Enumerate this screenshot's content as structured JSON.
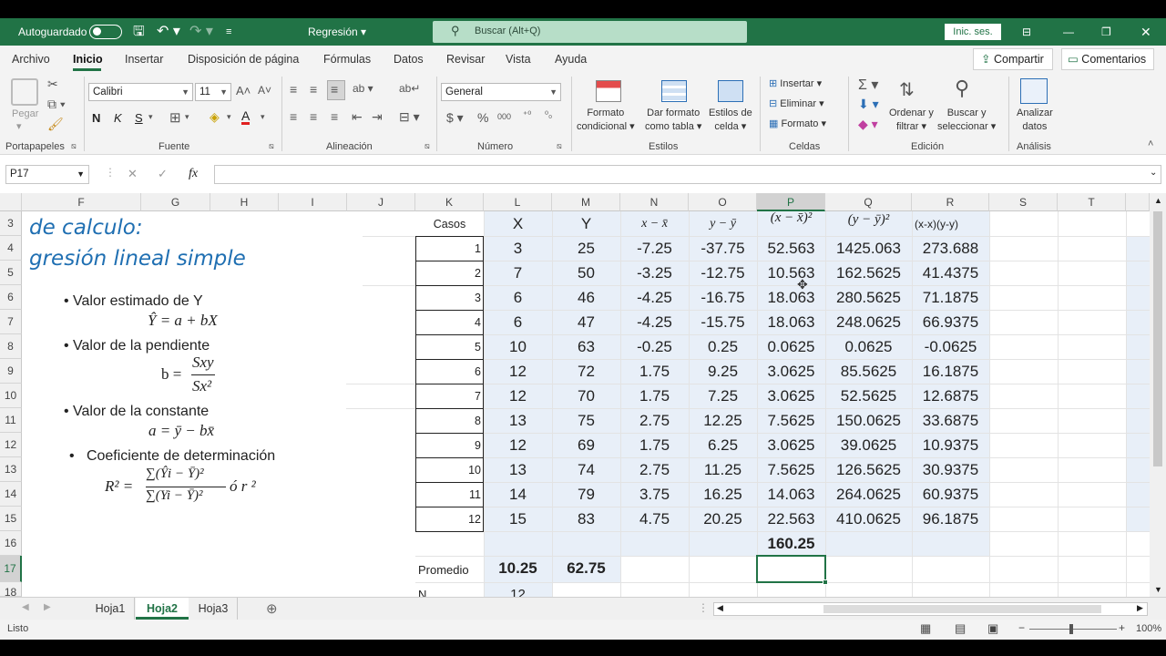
{
  "titlebar": {
    "autosave": "Autoguardado",
    "filename": "Regresión",
    "search_placeholder": "Buscar (Alt+Q)",
    "signin": "Inic. ses."
  },
  "menu": {
    "items": [
      "Archivo",
      "Inicio",
      "Insertar",
      "Disposición de página",
      "Fórmulas",
      "Datos",
      "Revisar",
      "Vista",
      "Ayuda"
    ],
    "share": "Compartir",
    "comments": "Comentarios"
  },
  "ribbon": {
    "paste": "Pegar",
    "font_name": "Calibri",
    "font_size": "11",
    "bold": "N",
    "italic": "K",
    "underline": "S",
    "number_format": "General",
    "cond_format_1": "Formato",
    "cond_format_2": "condicional",
    "table_format_1": "Dar formato",
    "table_format_2": "como tabla",
    "cell_styles_1": "Estilos de",
    "cell_styles_2": "celda",
    "insert": "Insertar",
    "delete": "Eliminar",
    "format": "Formato",
    "sort_1": "Ordenar y",
    "sort_2": "filtrar",
    "find_1": "Buscar y",
    "find_2": "seleccionar",
    "analyze_1": "Analizar",
    "analyze_2": "datos",
    "groups": {
      "clipboard": "Portapapeles",
      "font": "Fuente",
      "alignment": "Alineación",
      "number": "Número",
      "styles": "Estilos",
      "cells": "Celdas",
      "editing": "Edición",
      "analysis": "Análisis"
    }
  },
  "formula_bar": {
    "namebox": "P17",
    "fx": "fx",
    "value": ""
  },
  "columns": [
    "F",
    "G",
    "H",
    "I",
    "J",
    "K",
    "L",
    "M",
    "N",
    "O",
    "P",
    "Q",
    "R",
    "S",
    "T"
  ],
  "rows": [
    "3",
    "4",
    "5",
    "6",
    "7",
    "8",
    "9",
    "10",
    "11",
    "12",
    "13",
    "14",
    "15",
    "16",
    "17",
    "18"
  ],
  "slide": {
    "title_1": "de calculo:",
    "title_2": "gresión lineal simple",
    "b1": "Valor estimado de Y",
    "f1": "Ŷ = a + bX",
    "b2": "Valor de la pendiente",
    "f2_left": "b =",
    "f2_num": "Sxy",
    "f2_den": "Sx²",
    "b3": "Valor de la constante",
    "f3": "a = ȳ − bx̄",
    "b4": "Coeficiente de determinación",
    "f4_left": "R² =",
    "f4_num": "∑(Ŷi − Ȳ)²",
    "f4_den": "∑(Yi − Ȳ)²",
    "f4_right": "ó r ²"
  },
  "table": {
    "headers": {
      "casos": "Casos",
      "x": "X",
      "y": "Y",
      "n": "x − x̄",
      "o": "y − ȳ",
      "p": "(x − x̄)²",
      "q": "(y − ȳ)²",
      "r": "(x-x)(y-y)"
    },
    "rows": [
      {
        "caso": "1",
        "x": "3",
        "y": "25",
        "n": "-7.25",
        "o": "-37.75",
        "p": "52.563",
        "q": "1425.063",
        "r": "273.688"
      },
      {
        "caso": "2",
        "x": "7",
        "y": "50",
        "n": "-3.25",
        "o": "-12.75",
        "p": "10.563",
        "q": "162.5625",
        "r": "41.4375"
      },
      {
        "caso": "3",
        "x": "6",
        "y": "46",
        "n": "-4.25",
        "o": "-16.75",
        "p": "18.063",
        "q": "280.5625",
        "r": "71.1875"
      },
      {
        "caso": "4",
        "x": "6",
        "y": "47",
        "n": "-4.25",
        "o": "-15.75",
        "p": "18.063",
        "q": "248.0625",
        "r": "66.9375"
      },
      {
        "caso": "5",
        "x": "10",
        "y": "63",
        "n": "-0.25",
        "o": "0.25",
        "p": "0.0625",
        "q": "0.0625",
        "r": "-0.0625"
      },
      {
        "caso": "6",
        "x": "12",
        "y": "72",
        "n": "1.75",
        "o": "9.25",
        "p": "3.0625",
        "q": "85.5625",
        "r": "16.1875"
      },
      {
        "caso": "7",
        "x": "12",
        "y": "70",
        "n": "1.75",
        "o": "7.25",
        "p": "3.0625",
        "q": "52.5625",
        "r": "12.6875"
      },
      {
        "caso": "8",
        "x": "13",
        "y": "75",
        "n": "2.75",
        "o": "12.25",
        "p": "7.5625",
        "q": "150.0625",
        "r": "33.6875"
      },
      {
        "caso": "9",
        "x": "12",
        "y": "69",
        "n": "1.75",
        "o": "6.25",
        "p": "3.0625",
        "q": "39.0625",
        "r": "10.9375"
      },
      {
        "caso": "10",
        "x": "13",
        "y": "74",
        "n": "2.75",
        "o": "11.25",
        "p": "7.5625",
        "q": "126.5625",
        "r": "30.9375"
      },
      {
        "caso": "11",
        "x": "14",
        "y": "79",
        "n": "3.75",
        "o": "16.25",
        "p": "14.063",
        "q": "264.0625",
        "r": "60.9375"
      },
      {
        "caso": "12",
        "x": "15",
        "y": "83",
        "n": "4.75",
        "o": "20.25",
        "p": "22.563",
        "q": "410.0625",
        "r": "96.1875"
      }
    ],
    "sum_p": "160.25",
    "promedio_label": "Promedio",
    "prom_x": "10.25",
    "prom_y": "62.75",
    "n_label": "N",
    "n_value": "12"
  },
  "sheets": [
    "Hoja1",
    "Hoja2",
    "Hoja3"
  ],
  "status": {
    "ready": "Listo",
    "zoom": "100%"
  }
}
